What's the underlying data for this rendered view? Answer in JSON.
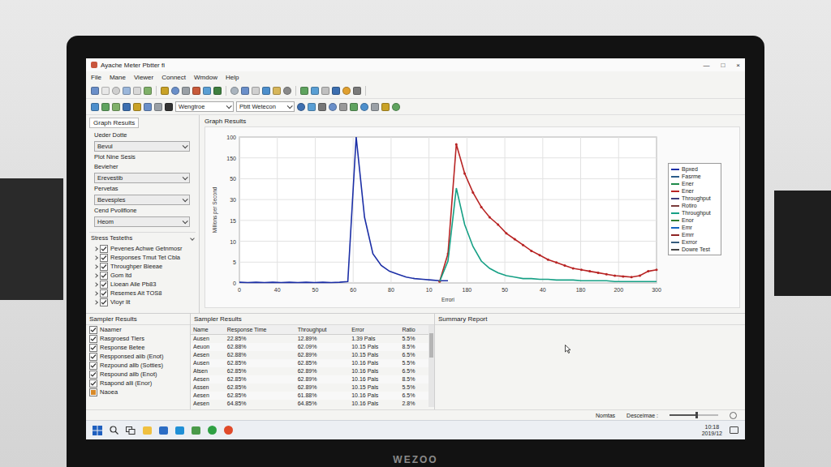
{
  "window": {
    "title": "Ayache Meter Pbtter fi",
    "controls": [
      "—",
      "□",
      "×"
    ]
  },
  "menu": [
    "File",
    "Mane",
    "Viewer",
    "Connect",
    "Wmdow",
    "Help"
  ],
  "toolbar": {
    "dropdowns": [
      "Wengtroe",
      "Pbtt Wetecon"
    ]
  },
  "config_panel": {
    "tab": "Graph Results",
    "items": [
      {
        "kind": "label",
        "text": "Ueder Dotte"
      },
      {
        "kind": "dropdown",
        "text": "Bevul"
      },
      {
        "kind": "label",
        "text": "Plot Nine Sesis"
      },
      {
        "kind": "label",
        "text": "Bevieher"
      },
      {
        "kind": "dropdown",
        "text": "Erevestib"
      },
      {
        "kind": "label",
        "text": "Pervetas"
      },
      {
        "kind": "dropdown",
        "text": "Bevesples"
      },
      {
        "kind": "label",
        "text": "Cend Pvollflone"
      },
      {
        "kind": "dropdown",
        "text": "Heom"
      }
    ],
    "tree": {
      "title": "Stress Testeths",
      "expanded": true,
      "items": [
        {
          "label": "Pevenes Achwe Getnmosr",
          "checked": true,
          "expanded": false
        },
        {
          "label": "Responses Tmut Tet Cbla",
          "checked": true,
          "expanded": false
        },
        {
          "label": "Throughper Bieeae",
          "checked": true,
          "expanded": false
        },
        {
          "label": "Gom ltd",
          "checked": true,
          "expanded": false
        },
        {
          "label": "Lioean Aile Pb83",
          "checked": true,
          "expanded": false
        },
        {
          "label": "Resemes Ait TOS8",
          "checked": true,
          "expanded": false
        },
        {
          "label": "Vioyr lit",
          "checked": true,
          "expanded": false
        }
      ]
    }
  },
  "chart": {
    "title": "Graph Results",
    "y_label": "Millions per Second",
    "x_label": "Errori",
    "y_max": 100,
    "x_max": 300,
    "y_ticks": [
      "100",
      "150",
      "50",
      "30",
      "15",
      "10",
      "5",
      "0"
    ],
    "x_ticks": [
      "0",
      "40",
      "50",
      "60",
      "80",
      "10",
      "180",
      "50",
      "40",
      "180",
      "200",
      "300"
    ],
    "series": [
      {
        "color": "#1c2fa6",
        "markers": false,
        "x_start": 0,
        "x_step": 6,
        "values": [
          0.5,
          0.3,
          0.5,
          0.3,
          0.5,
          0.3,
          0.5,
          0.3,
          0.5,
          0.3,
          0.5,
          0.3,
          0.5,
          1,
          100,
          45,
          20,
          12,
          8,
          6,
          4,
          3,
          2.5,
          2,
          1.5,
          1.5
        ]
      },
      {
        "color": "#b82424",
        "markers": true,
        "x_start": 144,
        "x_step": 6,
        "values": [
          1,
          20,
          95,
          75,
          62,
          52,
          45,
          40,
          34,
          30,
          26,
          22,
          19,
          16,
          14,
          12,
          10,
          9,
          8,
          7,
          6,
          5,
          4.5,
          4,
          5,
          8,
          9
        ]
      },
      {
        "color": "#16a085",
        "markers": false,
        "x_start": 144,
        "x_step": 6,
        "values": [
          1,
          15,
          65,
          40,
          25,
          15,
          10,
          7,
          5,
          4,
          3,
          3,
          2.5,
          2.5,
          2,
          2,
          2,
          1.5,
          1.5,
          1.5,
          1.5,
          1,
          1,
          1,
          1,
          1,
          1
        ]
      }
    ],
    "legend": [
      {
        "label": "Bpxed",
        "color": "#1c2fa6"
      },
      {
        "label": "Fasrme",
        "color": "#2a5c8a"
      },
      {
        "label": "Ener",
        "color": "#1e8a4a"
      },
      {
        "label": "Ener",
        "color": "#b82424"
      },
      {
        "label": "Throughput",
        "color": "#3b3b7a"
      },
      {
        "label": "Rotiro",
        "color": "#7a3b3b"
      },
      {
        "label": "Throughput",
        "color": "#16a085"
      },
      {
        "label": "Enor",
        "color": "#2e7d32"
      },
      {
        "label": "Emr",
        "color": "#1565c0"
      },
      {
        "label": "Emrr",
        "color": "#8e2424"
      },
      {
        "label": "Exrror",
        "color": "#355c7d"
      },
      {
        "label": "Dowre Test",
        "color": "#444444"
      }
    ]
  },
  "sampler_list": {
    "title": "Sampler Results",
    "items": [
      {
        "label": "Naamer",
        "checked": true
      },
      {
        "label": "Rasgroesd Tlers",
        "checked": true
      },
      {
        "label": "Response Betee",
        "checked": true
      },
      {
        "label": "Respponsed aiib (Enot)",
        "checked": true
      },
      {
        "label": "Rezpound allb (Sotties)",
        "checked": true
      },
      {
        "label": "Respound ailb (Enot)",
        "checked": true
      },
      {
        "label": "Rsapond alli (Enor)",
        "checked": true
      },
      {
        "label": "Naoea",
        "checked": false
      }
    ]
  },
  "sampler_table": {
    "title": "Sampler Results",
    "columns": [
      "Name",
      "Response Time",
      "Throughput",
      "Error",
      "Ratio"
    ],
    "rows": [
      [
        "Ausen",
        "22.85%",
        "12.89%",
        "1.39 Pals",
        "5.5%"
      ],
      [
        "Aeuon",
        "62.88%",
        "62.09%",
        "10.15 Pals",
        "8.5%"
      ],
      [
        "Aesen",
        "62.88%",
        "62.89%",
        "10.15 Pals",
        "6.5%"
      ],
      [
        "Ausen",
        "62.85%",
        "62.85%",
        "10.16 Pals",
        "5.5%"
      ],
      [
        "Atsen",
        "62.85%",
        "62.89%",
        "10.16 Pals",
        "6.5%"
      ],
      [
        "Aesen",
        "62.85%",
        "62.89%",
        "10.16 Pals",
        "8.5%"
      ],
      [
        "Assen",
        "62.85%",
        "62.89%",
        "10.15 Pals",
        "5.5%"
      ],
      [
        "Aesen",
        "62.85%",
        "61.88%",
        "10.16 Pals",
        "6.5%"
      ],
      [
        "Aesen",
        "64.85%",
        "64.85%",
        "10.16 Pals",
        "2.8%"
      ]
    ]
  },
  "summary": {
    "title": "Summary Report"
  },
  "status_bar": {
    "left": "Nomtas",
    "right": "Desceimae :",
    "level": 0.55
  },
  "taskbar": {
    "time": "10:18",
    "date": "2019/12"
  },
  "monitor": {
    "brand": "WEZOO"
  }
}
